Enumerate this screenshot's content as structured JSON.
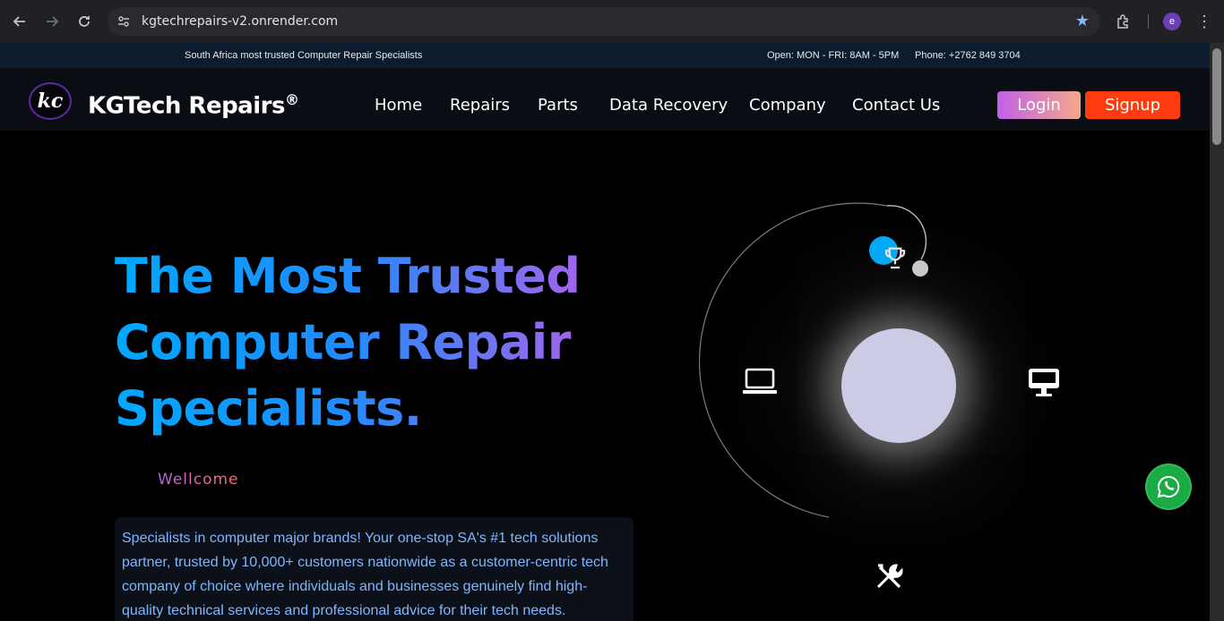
{
  "browser": {
    "url": "kgtechrepairs-v2.onrender.com",
    "profile_initial": "e"
  },
  "topbar": {
    "tagline": "South Africa most trusted Computer Repair Specialists",
    "hours": "Open: MON - FRI: 8AM - 5PM",
    "phone": "Phone: +2762 849 3704"
  },
  "header": {
    "brand": "KGTech Repairs",
    "brand_mark": "®",
    "logo_text": "kc",
    "nav": [
      "Home",
      "Repairs",
      "Parts",
      "Data Recovery",
      "Company",
      "Contact Us"
    ],
    "login": "Login",
    "signup": "Signup"
  },
  "hero": {
    "title_line1": "The Most Trusted",
    "title_line2": "Computer Repair",
    "title_line3": "Specialists.",
    "welcome": "Wellcome",
    "description": "Specialists in computer major brands! Your one-stop SA's #1 tech solutions partner, trusted by 10,000+ customers nationwide as a customer-centric tech company of choice where individuals and businesses genuinely find high-quality technical services and professional advice for their tech needs."
  },
  "colors": {
    "topbar_bg": "#0d1b2e",
    "header_bg": "#0b0d14",
    "signup": "#ff3b0f",
    "orb_blue": "#03a9f4",
    "whatsapp": "#1bab45"
  },
  "icons": [
    "trophy-icon",
    "laptop-icon",
    "monitor-icon",
    "tools-icon",
    "whatsapp-icon"
  ]
}
